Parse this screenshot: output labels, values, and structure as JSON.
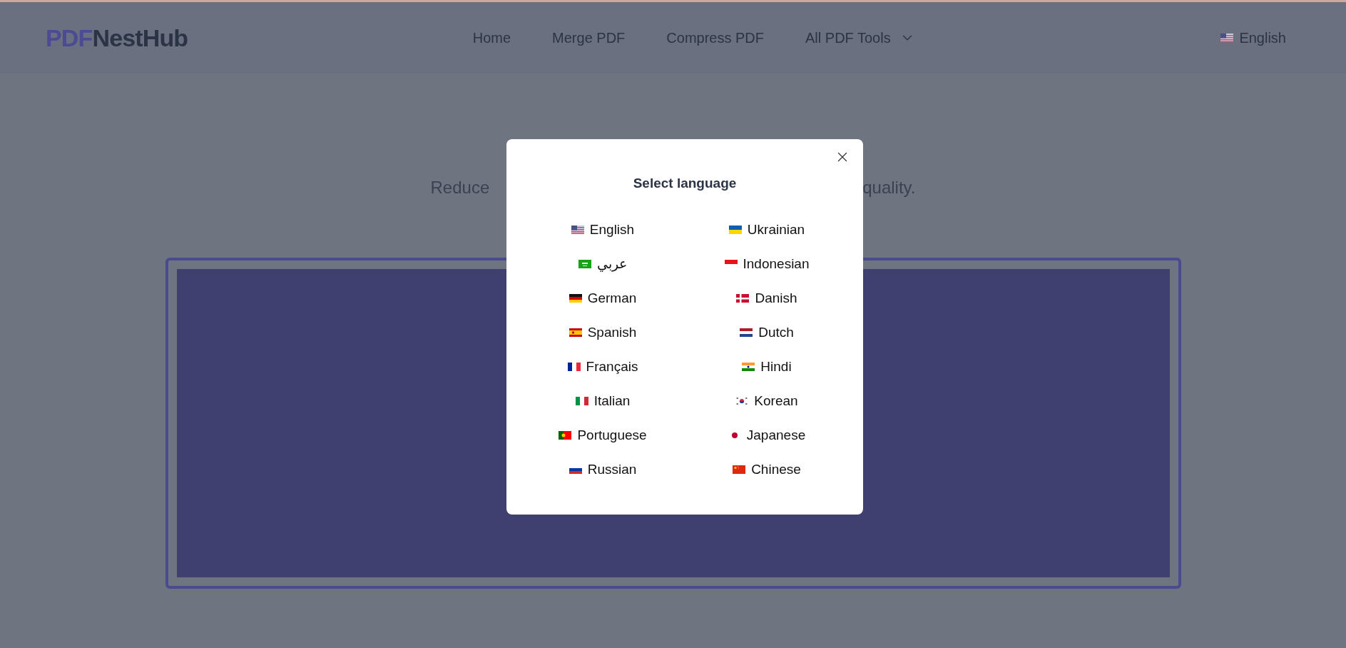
{
  "header": {
    "logo": {
      "accent": "PDF",
      "rest": "NestHub"
    },
    "nav": [
      {
        "label": "Home",
        "dropdown": false
      },
      {
        "label": "Merge PDF",
        "dropdown": false
      },
      {
        "label": "Compress PDF",
        "dropdown": false
      },
      {
        "label": "All PDF Tools",
        "dropdown": true
      }
    ],
    "language": "English"
  },
  "hero": {
    "subtitle_start": "Reduce",
    "subtitle_end": "quality."
  },
  "dialog": {
    "title": "Select language",
    "languages": [
      {
        "label": "English"
      },
      {
        "label": "Ukrainian"
      },
      {
        "label": "عربي"
      },
      {
        "label": "Indonesian"
      },
      {
        "label": "German"
      },
      {
        "label": "Danish"
      },
      {
        "label": "Spanish"
      },
      {
        "label": "Dutch"
      },
      {
        "label": "Français"
      },
      {
        "label": "Hindi"
      },
      {
        "label": "Italian"
      },
      {
        "label": "Korean"
      },
      {
        "label": "Portuguese"
      },
      {
        "label": "Japanese"
      },
      {
        "label": "Russian"
      },
      {
        "label": "Chinese"
      }
    ]
  }
}
